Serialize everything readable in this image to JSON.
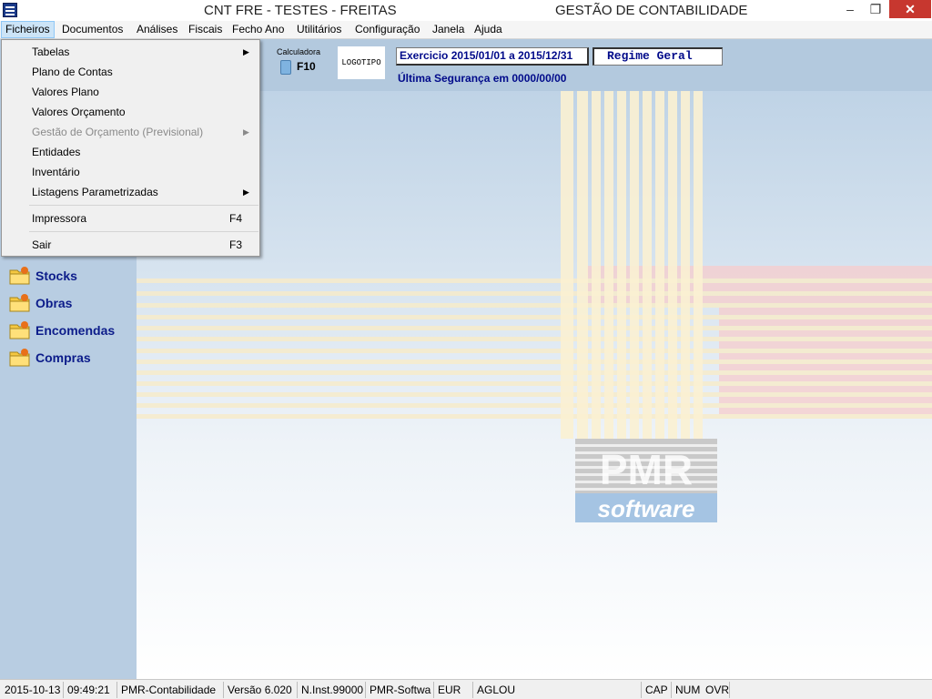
{
  "window": {
    "title_left": "CNT FRE - TESTES - FREITAS",
    "title_right": "GESTÃO DE CONTABILIDADE",
    "controls": {
      "minimize": "–",
      "maximize": "❐",
      "close": "✕"
    }
  },
  "menubar": {
    "items": [
      "Ficheiros",
      "Documentos",
      "Análises",
      "Fiscais",
      "Fecho Ano",
      "Utilitários",
      "Configuração",
      "Janela",
      "Ajuda"
    ],
    "active": "Ficheiros"
  },
  "toolbar": {
    "calculator_label": "Calculadora",
    "calculator_key": "F10",
    "logo_text": "LOGOTIPO",
    "exercise": "Exercicio 2015/01/01 a 2015/12/31",
    "regime": "Regime Geral",
    "last_backup": "Última Segurança em 0000/00/00"
  },
  "sidebar": {
    "modules": [
      "Stocks",
      "Obras",
      "Encomendas",
      "Compras"
    ]
  },
  "dropdown": {
    "items": [
      {
        "label": "Tabelas",
        "submenu": true,
        "disabled": false,
        "shortcut": ""
      },
      {
        "label": "Plano de Contas",
        "submenu": false,
        "disabled": false,
        "shortcut": ""
      },
      {
        "label": "Valores Plano",
        "submenu": false,
        "disabled": false,
        "shortcut": ""
      },
      {
        "label": "Valores Orçamento",
        "submenu": false,
        "disabled": false,
        "shortcut": ""
      },
      {
        "label": "Gestão de Orçamento (Previsional)",
        "submenu": true,
        "disabled": true,
        "shortcut": ""
      },
      {
        "label": "Entidades",
        "submenu": false,
        "disabled": false,
        "shortcut": ""
      },
      {
        "label": "Inventário",
        "submenu": false,
        "disabled": false,
        "shortcut": ""
      },
      {
        "label": "Listagens Parametrizadas",
        "submenu": true,
        "disabled": false,
        "shortcut": ""
      },
      {
        "label": "Impressora",
        "submenu": false,
        "disabled": false,
        "shortcut": "F4"
      },
      {
        "label": "Sair",
        "submenu": false,
        "disabled": false,
        "shortcut": "F3"
      }
    ]
  },
  "watermark": {
    "brand_top": "PMR",
    "brand_bottom": "software"
  },
  "statusbar": {
    "date": "2015-10-13",
    "time": "09:49:21",
    "app": "PMR-Contabilidade",
    "version": "Versão 6.020",
    "install": "N.Inst.99000",
    "vendor": "PMR-Softwa",
    "currency": "EUR",
    "user": "AGLOU",
    "cap": "CAP",
    "num": "NUM",
    "ovr": "OVR"
  },
  "colors": {
    "sidebar_bg": "#b8cde2",
    "module_text": "#0c1c8a",
    "highlight_blue": "#000a8a",
    "menu_active_bg": "#cce4f7",
    "close_button": "#c7372f"
  }
}
